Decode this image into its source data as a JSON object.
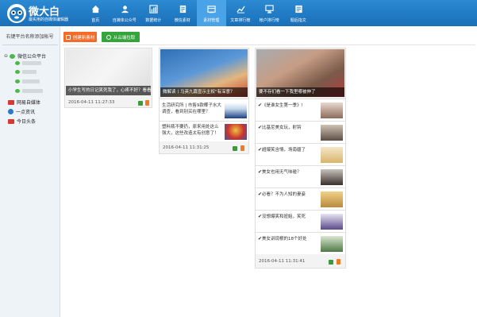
{
  "app": {
    "name": "微大白",
    "tagline": "最实用的自媒体编辑器"
  },
  "nav": [
    {
      "label": "首页",
      "icon": "home-icon"
    },
    {
      "label": "自媒体公众号",
      "icon": "account-icon"
    },
    {
      "label": "数据统计",
      "icon": "stats-icon"
    },
    {
      "label": "微信素材",
      "icon": "wechat-material-icon"
    },
    {
      "label": "素材管理",
      "icon": "material-manage-icon",
      "active": true
    },
    {
      "label": "文章排行榜",
      "icon": "article-rank-icon"
    },
    {
      "label": "帐户排行榜",
      "icon": "account-rank-icon"
    },
    {
      "label": "题后指文",
      "icon": "text-icon"
    }
  ],
  "sidebar": {
    "hint": "右键平台名称添加帐号",
    "root": "微信公众平台",
    "platforms": [
      "网易自媒体",
      "一点资讯",
      "今日头条"
    ]
  },
  "toolbar": {
    "create_label": "创建新素材",
    "cloud_label": "从云端拉取"
  },
  "cards": [
    {
      "caption": "小学生写的日记笑死我了，心疼不好？看看！",
      "date": "2016-04-11 11:27:33",
      "items": []
    },
    {
      "caption": "微解读丨马英九篇宣示主权\"有深意？",
      "date": "2016-04-11 11:31:25",
      "items": [
        {
          "text": "生活研究所 | 市售9款椰子水大调查，看到别买在哪里？"
        },
        {
          "text": "塑料瓶不要扔，原来用处这么强大，这些改造太有创意了！"
        }
      ]
    },
    {
      "caption": "要不存们看一下我里哪被伸了",
      "date": "2016-04-11 11:31:41",
      "items": [
        {
          "text": "《是谁女生第一季》!"
        },
        {
          "text": "比基尼美女玩，射钩"
        },
        {
          "text": "超爆笑含情，场南疆了"
        },
        {
          "text": "美女也用无气味碰？"
        },
        {
          "text": "必看？不为人知的妻妾"
        },
        {
          "text": "没想爆笑和妞姐，笑死"
        },
        {
          "text": "美女讲现根的18个好处"
        }
      ]
    }
  ],
  "colors": {
    "header": "#1f7cc5",
    "nav_active": "#4aa3e6",
    "orange_btn": "#f36c2a",
    "green_btn": "#33a53a",
    "sidebar_bg": "#eef3f7"
  }
}
